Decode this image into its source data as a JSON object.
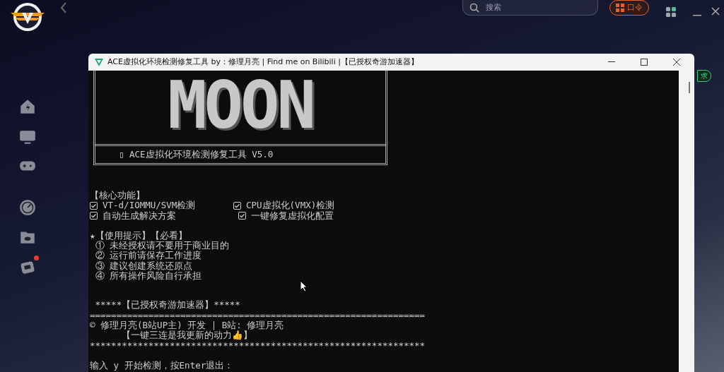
{
  "app": {
    "search": {
      "placeholder": "搜索"
    },
    "code_button": "口令",
    "side_badge": "求"
  },
  "sidebar": {
    "items": [
      {
        "badge": false
      },
      {
        "badge": false
      },
      {
        "badge": false
      },
      {
        "badge": false
      },
      {
        "badge": false
      },
      {
        "badge": true
      }
    ]
  },
  "console": {
    "title": "ACE虚拟化环境检测修复工具 by：修理月亮 | Find me on Bilibili |【已授权奇游加速器】",
    "banner": "MOON",
    "banner_subtitle": "▯ ACE虚拟化环境检测修复工具 V5.0",
    "core_heading": "【核心功能】",
    "features": [
      {
        "label": "VT-d/IOMMU/SVM检测",
        "checked": true
      },
      {
        "label": "CPU虚拟化(VMX)检测",
        "checked": true
      },
      {
        "label": "自动生成解决方案",
        "checked": true
      },
      {
        "label": "一键修复虚拟化配置",
        "checked": true
      }
    ],
    "tips_heading": "★【使用提示】【必看】",
    "tips": [
      "① 未经授权请不要用于商业目的",
      "② 运行前请保存工作进度",
      "③ 建议创建系统还原点",
      "④ 所有操作风险自行承担"
    ],
    "license": "*****【已授权奇游加速器】*****",
    "rule_top": "===============================================================",
    "credit": "© 修理月亮(B站UP主) 开发 | B站: 修理月亮",
    "slogan": "【一键三连是我更新的动力👍】",
    "rule_bottom": "***************************************************************",
    "prompt": "输入 y 开始检测，按Enter退出："
  }
}
